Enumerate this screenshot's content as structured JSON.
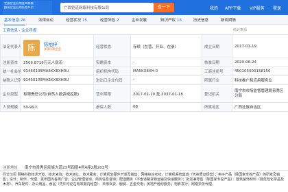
{
  "header": {
    "logo_line1": "全国企业信用查询系统",
    "logo_line2": "国家企业信用信息公示",
    "search_value": "广西钜道网络科技有限公司",
    "search_button": "查一下",
    "links": [
      "我的",
      "APP下载",
      "VIP服务",
      "登录"
    ]
  },
  "tabs": [
    {
      "label": "基本信息",
      "count": "26"
    },
    {
      "label": "法律诉讼",
      "count": ""
    },
    {
      "label": "经营状况",
      "count": "15"
    },
    {
      "label": "经营风险",
      "count": "2"
    },
    {
      "label": "企业发展",
      "count": ""
    },
    {
      "label": "知识产权",
      "count": "16"
    },
    {
      "label": "历史信息",
      "count": ""
    },
    {
      "label": "新闻舆情",
      "count": ""
    }
  ],
  "subtabs": {
    "active": "工商信息",
    "more_icon": "more-icon"
  },
  "section": {
    "title": "工商信息",
    "link": "企业年报",
    "right": "统计来源"
  },
  "person": {
    "avatar_char": "陈",
    "name": "陈柏梓",
    "tag": "关联3家企业"
  },
  "rows": [
    {
      "l1": "法定代表人",
      "v1": "",
      "l2": "经营状态",
      "v2": "存续（在营、开业、在册）",
      "l3": "成立日期",
      "v3": "2017-01-19"
    },
    {
      "l1": "注册资本",
      "v1": "2506.8718万元人民币",
      "l2": "实缴资本",
      "v2": "-",
      "l3": "核准日期",
      "v3": "2020-06-24"
    },
    {
      "l1": "统一社会信用代码",
      "v1": "91450105MA5KX8XH0U",
      "l2": "组织机构代码",
      "v2": "MA5KX8XH-0",
      "l3": "工商注册号",
      "v3": "450105000158150"
    },
    {
      "l1": "纳税人识别号",
      "v1": "91450105MA5KX8XH0U",
      "l2": "进出口企业代码",
      "v2": "-",
      "l3": "所属行业",
      "v3": "科技推广和应用服务业"
    },
    {
      "l1": "企业类型",
      "v1": "有限责任公司(自然人投资或控股)",
      "l2": "营业期限",
      "v2": "2017-01-19 至 2037-01-18",
      "l3": "登记机关",
      "v3": "南宁市市场监督管理局青秀区分局"
    },
    {
      "l1": "人员规模",
      "v1": "50-99人",
      "l2": "参保人数",
      "v2": "68",
      "l3": "所属地区",
      "v3": "广西壮族自治区"
    }
  ],
  "address": {
    "label": "注册地址",
    "value": "南宁市青秀区民族大道23号四层4号A座2层203号"
  },
  "scope": {
    "label": "经营范围",
    "value": "网络科技技术开发、技术咨询、技术转让、技术服务；计算机软硬件开发及销售；网络综合布线，计算机系统集成（凭资质证经营）；电子产品（除国家专控产品）的研发及销售；设计、制作、代理、发布国内各类广告；企业管理咨询，商务信息咨询；配送服务（不含道路货物运输及快递服务）；批发兼零售（除国家专控产品）：建筑装饰材料（除危险化学品及木材）、汽车配件、办公用品、食品（凭许可证在有效期内经营）、日用百货、服装、五金交电；房地产经纪服务；电影发行；网络票务代理。"
  }
}
